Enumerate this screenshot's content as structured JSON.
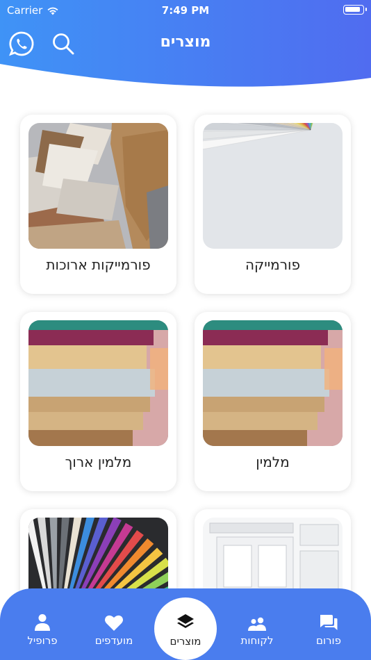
{
  "status_bar": {
    "carrier": "Carrier",
    "time": "7:49 PM"
  },
  "header": {
    "title": "מוצרים"
  },
  "products": [
    {
      "label": "פורמייקה",
      "image": "color-fan-laminate"
    },
    {
      "label": "פורמייקות ארוכות",
      "image": "wood-laminate-samples"
    },
    {
      "label": "מלמין",
      "image": "board-stack"
    },
    {
      "label": "מלמין ארוך",
      "image": "board-stack"
    },
    {
      "label": "",
      "image": "white-cabinet-doors"
    },
    {
      "label": "",
      "image": "color-fan-laminate-dark"
    }
  ],
  "nav": {
    "items": [
      {
        "label": "פורום",
        "icon": "forum-icon"
      },
      {
        "label": "לקוחות",
        "icon": "people-icon"
      },
      {
        "label": "מוצרים",
        "icon": "layers-icon",
        "active": true
      },
      {
        "label": "מועדפים",
        "icon": "heart-icon"
      },
      {
        "label": "פרופיל",
        "icon": "person-icon"
      }
    ]
  },
  "colors": {
    "header_start": "#3d8cf7",
    "header_end": "#4e6ff0",
    "nav": "#4a7dee"
  }
}
